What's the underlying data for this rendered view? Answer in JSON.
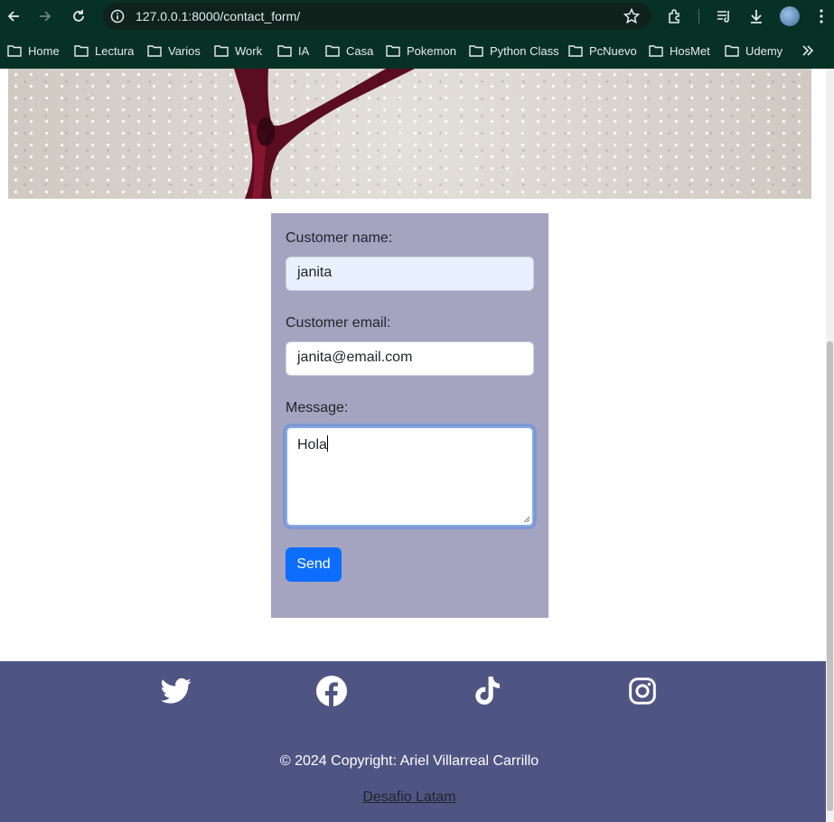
{
  "browser": {
    "url": "127.0.0.1:8000/contact_form/",
    "bookmarks": [
      "Home",
      "Lectura",
      "Varios",
      "Work",
      "IA",
      "Casa",
      "Pokemon",
      "Python Class",
      "PcNuevo",
      "HosMet",
      "Udemy"
    ],
    "toolbar_colors": {
      "frame": "#083126",
      "omnibox": "#0f221c",
      "text": "#e8eaed"
    },
    "icons": [
      "back-icon",
      "forward-icon",
      "reload-icon",
      "site-info-icon",
      "star-icon",
      "extensions-icon",
      "reading-list-icon",
      "download-icon",
      "profile-avatar",
      "menu-icon",
      "folder-icon",
      "chevron-double-right-icon"
    ]
  },
  "form": {
    "name_label": "Customer name:",
    "name_value": "janita",
    "email_label": "Customer email:",
    "email_value": "janita@email.com",
    "message_label": "Message:",
    "message_value": "Hola",
    "send_label": "Send",
    "colors": {
      "panel": "#a4a4c1",
      "button": "#0d6efd",
      "autofill": "#e8f0fe"
    }
  },
  "footer": {
    "social": [
      "twitter-icon",
      "facebook-icon",
      "tiktok-icon",
      "instagram-icon"
    ],
    "copyright": "© 2024 Copyright: Ariel Villarreal Carrillo",
    "link_text": "Desafio Latam",
    "background": "#4f5583"
  }
}
